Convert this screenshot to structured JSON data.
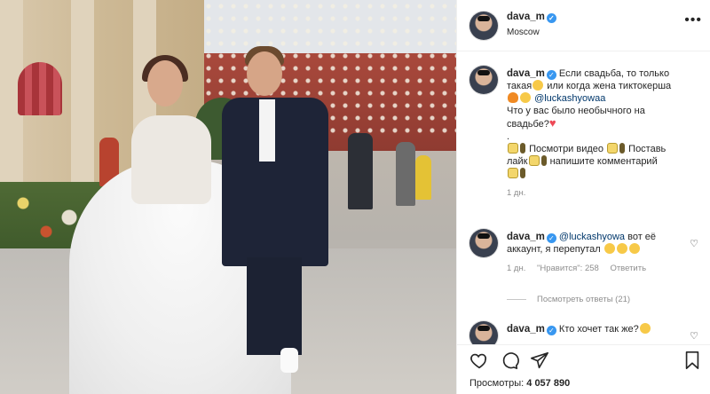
{
  "post": {
    "username": "dava_m",
    "location": "Moscow",
    "more_label": "•••"
  },
  "comments": [
    {
      "username": "dava_m",
      "segments": [
        {
          "text": "Если свадьба, то только такая"
        },
        {
          "emoji": "laugh-emoji"
        },
        {
          "text": " или когда жена тиктокерша "
        },
        {
          "emoji": "fire-emoji"
        },
        {
          "emoji": "laugh-emoji"
        },
        {
          "mention": "@luckashyowaa"
        }
      ],
      "line2": "Что у вас было необычного на свадьбе?",
      "line2_emoji": "heart-emoji",
      "dot": ".",
      "line3_a": "Посмотри видео",
      "line3_b": "Поставь лайк",
      "line3_c": "напишите комментарий",
      "time": "1 дн."
    },
    {
      "username": "dava_m",
      "mention": "@luckashyowa",
      "text": " вот её аккаунт, я перепутал",
      "time": "1 дн.",
      "likes": "\"Нравится\": 258",
      "reply": "Ответить",
      "replies_label": "Посмотреть ответы (21)"
    },
    {
      "username": "dava_m",
      "text": "Кто хочет так же?"
    }
  ],
  "footer": {
    "views_label": "Просмотры:",
    "views_count": "4 057 890"
  },
  "icons": [
    "heart-icon",
    "comment-icon",
    "share-icon",
    "bookmark-icon"
  ],
  "colors": {
    "link": "#00376b",
    "verified": "#3897f0",
    "muted": "#8e8e8e",
    "like_heart": "#ed4956"
  }
}
